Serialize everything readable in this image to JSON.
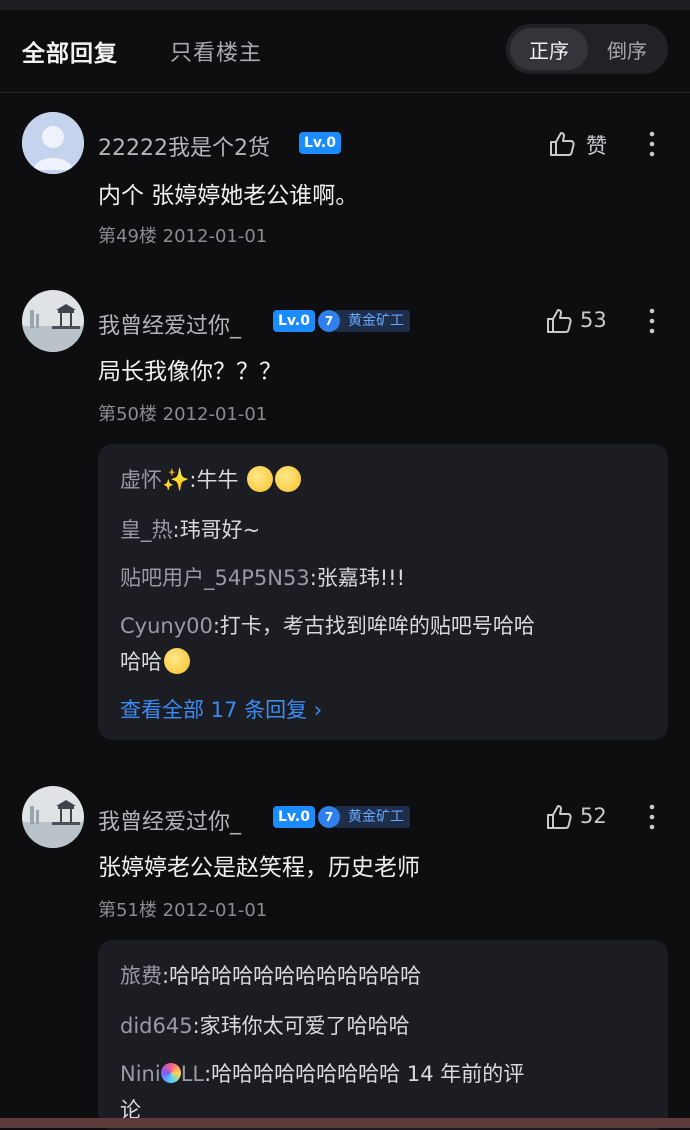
{
  "header": {
    "tab_all": "全部回复",
    "tab_owner_only": "只看楼主",
    "sort_asc": "正序",
    "sort_desc": "倒序"
  },
  "posts": [
    {
      "username": "22222我是个2货",
      "level": "Lv.0",
      "like_label": "赞",
      "content": "内个 张婷婷她老公谁啊。",
      "floor": "第49楼",
      "date": "2012-01-01"
    },
    {
      "username": "我曾经爱过你_",
      "level": "Lv.0",
      "badge_num": "7",
      "badge_title": "黄金矿工",
      "like_count": "53",
      "content": "局长我像你？？？",
      "floor": "第50楼",
      "date": "2012-01-01",
      "replies": [
        {
          "name": "虚怀",
          "text": ":牛牛"
        },
        {
          "name": "皇_热",
          "text": ":玮哥好~"
        },
        {
          "name": "贴吧用户_54P5N53",
          "text": ":张嘉玮!!!"
        },
        {
          "name": "Cyuny00",
          "text": ":打卡，考古找到哞哞的贴吧号哈哈",
          "text2": "哈哈"
        }
      ],
      "view_all": "查看全部 17 条回复 ›"
    },
    {
      "username": "我曾经爱过你_",
      "level": "Lv.0",
      "badge_num": "7",
      "badge_title": "黄金矿工",
      "like_count": "52",
      "content": "张婷婷老公是赵笑程，历史老师",
      "floor": "第51楼",
      "date": "2012-01-01",
      "replies": [
        {
          "name": "旅费",
          "text": ":哈哈哈哈哈哈哈哈哈哈哈哈"
        },
        {
          "name": "did645",
          "text": ":家玮你太可爱了哈哈哈"
        },
        {
          "name": "Nini",
          "name2": "LL",
          "text": ":哈哈哈哈哈哈哈哈哈 14 年前的评",
          "text2": "论"
        }
      ]
    }
  ]
}
